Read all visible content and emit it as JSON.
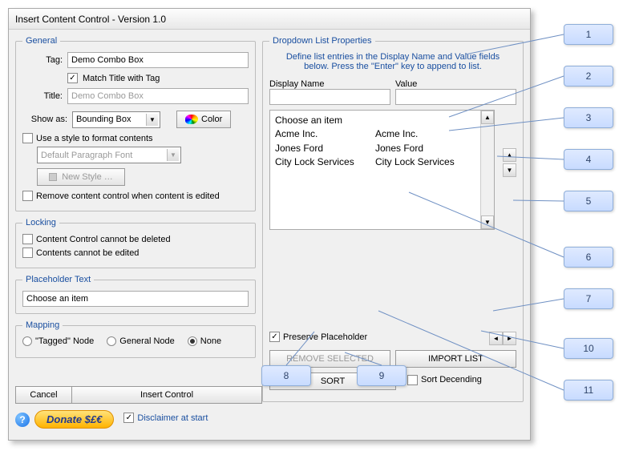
{
  "window": {
    "title": "Insert Content Control - Version 1.0"
  },
  "general": {
    "legend": "General",
    "tag_label": "Tag:",
    "tag_value": "Demo Combo Box",
    "match_title_label": "Match Title with Tag",
    "match_title_checked": true,
    "title_label": "Title:",
    "title_placeholder": "Demo Combo Box",
    "show_as_label": "Show as:",
    "show_as_value": "Bounding Box",
    "color_button": "Color",
    "use_style_label": "Use a style to format contents",
    "use_style_checked": false,
    "style_select": "Default Paragraph Font",
    "new_style_button": "New Style …",
    "remove_on_edit_label": "Remove content control when content is edited",
    "remove_on_edit_checked": false
  },
  "locking": {
    "legend": "Locking",
    "no_delete_label": "Content Control cannot be deleted",
    "no_delete_checked": false,
    "no_edit_label": "Contents cannot be edited",
    "no_edit_checked": false
  },
  "placeholder": {
    "legend": "Placeholder Text",
    "value": "Choose an item"
  },
  "mapping": {
    "legend": "Mapping",
    "opt_tagged": "\"Tagged\" Node",
    "opt_general": "General Node",
    "opt_none": "None",
    "selected": "none"
  },
  "bottom": {
    "cancel": "Cancel",
    "insert": "Insert Control",
    "donate": "Donate $£€",
    "disclaimer_label": "Disclaimer at start",
    "disclaimer_checked": true
  },
  "dropdown": {
    "legend": "Dropdown List Properties",
    "instruction": "Define list entries in the Display Name and Value fields below. Press the \"Enter\" key to append to list.",
    "display_name_label": "Display Name",
    "value_label": "Value",
    "display_name_value": "",
    "value_value": "",
    "rows": [
      {
        "display": "Choose an item",
        "value": ""
      },
      {
        "display": "Acme Inc.",
        "value": "Acme Inc."
      },
      {
        "display": "Jones Ford",
        "value": "Jones Ford"
      },
      {
        "display": "City Lock Services",
        "value": "City Lock Services"
      }
    ],
    "preserve_label": "Preserve Placeholder",
    "preserve_checked": true,
    "remove_selected": "REMOVE SELECTED",
    "import_list": "IMPORT LIST",
    "sort": "SORT",
    "sort_desc_label": "Sort Decending",
    "sort_desc_checked": false
  },
  "callouts": {
    "c1": "1",
    "c2": "2",
    "c3": "3",
    "c4": "4",
    "c5": "5",
    "c6": "6",
    "c7": "7",
    "c8": "8",
    "c9": "9",
    "c10": "10",
    "c11": "11"
  }
}
